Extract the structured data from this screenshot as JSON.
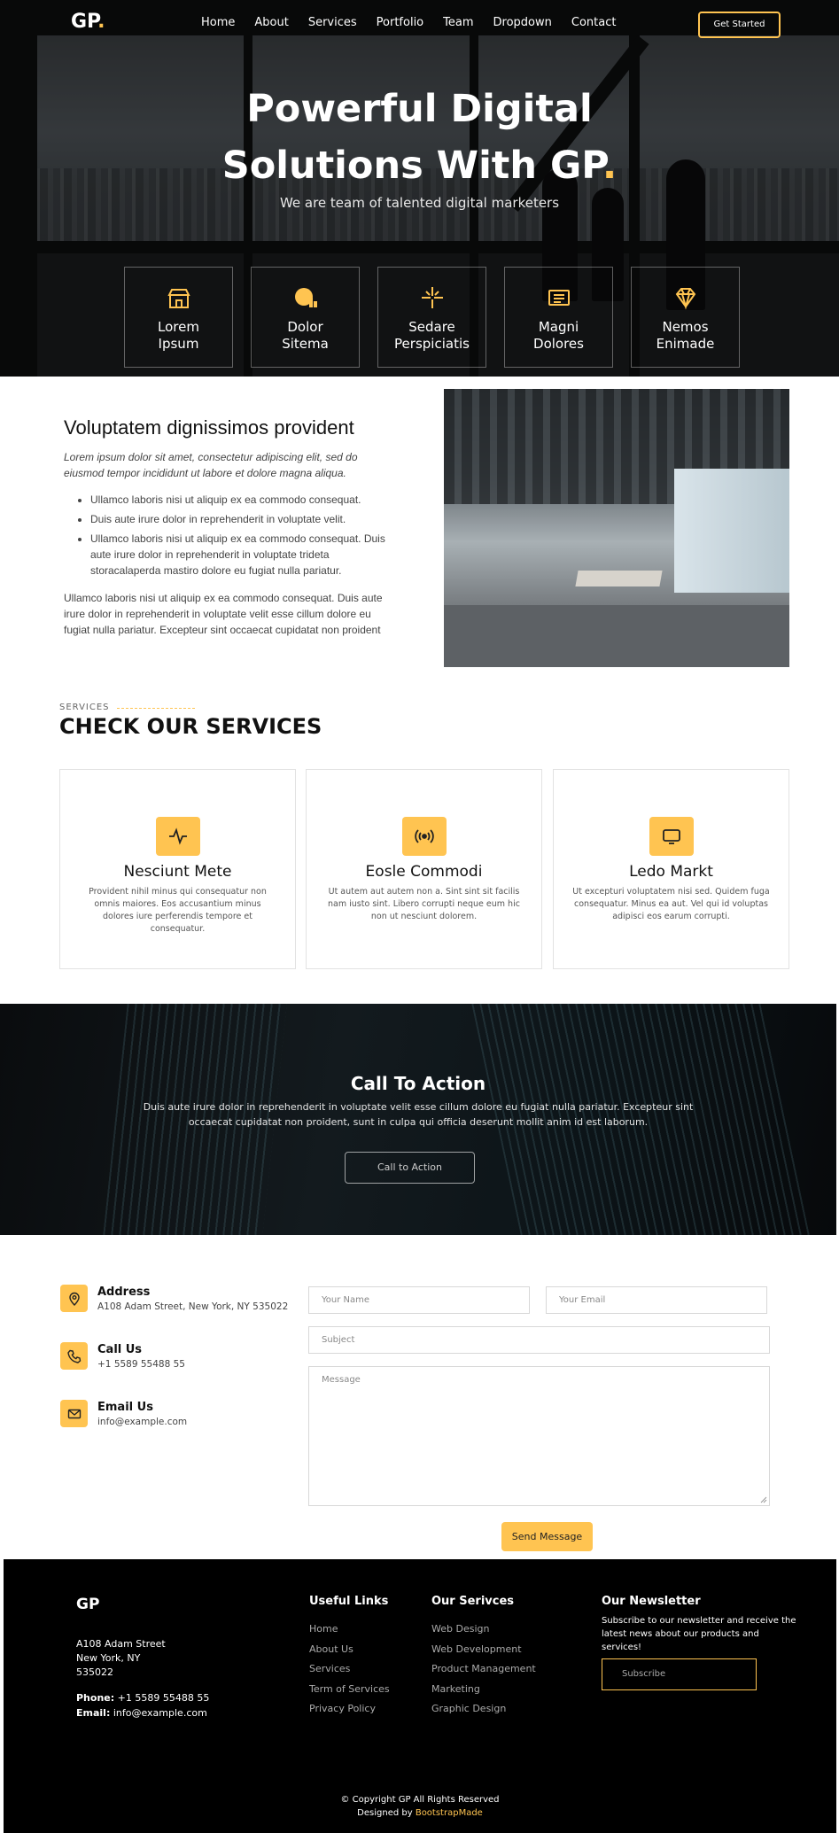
{
  "brand": {
    "name": "GP",
    "dot": ".",
    "accent_color": "#ffc451"
  },
  "nav": {
    "items": [
      "Home",
      "About",
      "Services",
      "Portfolio",
      "Team",
      "Dropdown",
      "Contact"
    ],
    "cta_label": "Get Started"
  },
  "hero": {
    "title_line1": "Powerful Digital",
    "title_line2": "Solutions With GP",
    "title_dot": ".",
    "subtitle": "We are team of talented digital marketers",
    "boxes": [
      {
        "icon": "store-icon",
        "line1": "Lorem",
        "line2": "Ipsum"
      },
      {
        "icon": "bar-chart-icon",
        "line1": "Dolor",
        "line2": "Sitema"
      },
      {
        "icon": "calendar-icon",
        "line1": "Sedare",
        "line2": "Perspiciatis"
      },
      {
        "icon": "paint-bucket-icon",
        "line1": "Magni",
        "line2": "Dolores"
      },
      {
        "icon": "gem-icon",
        "line1": "Nemos",
        "line2": "Enimade"
      }
    ]
  },
  "about": {
    "title": "Voluptatem dignissimos provident",
    "intro": "Lorem ipsum dolor sit amet, consectetur adipiscing elit, sed do eiusmod tempor incididunt ut labore et dolore magna aliqua.",
    "bullets": [
      "Ullamco laboris nisi ut aliquip ex ea commodo consequat.",
      "Duis aute irure dolor in reprehenderit in voluptate velit.",
      "Ullamco laboris nisi ut aliquip ex ea commodo consequat. Duis aute irure dolor in reprehenderit in voluptate trideta storacalaperda mastiro dolore eu fugiat nulla pariatur."
    ],
    "paragraph": "Ullamco laboris nisi ut aliquip ex ea commodo consequat. Duis aute irure dolor in reprehenderit in voluptate velit esse cillum dolore eu fugiat nulla pariatur. Excepteur sint occaecat cupidatat non proident"
  },
  "services": {
    "eyebrow": "SERVICES",
    "title": "CHECK OUR SERVICES",
    "cards": [
      {
        "icon": "activity-icon",
        "name": "Nesciunt Mete",
        "desc": "Provident nihil minus qui consequatur non omnis maiores. Eos accusantium minus dolores iure perferendis tempore et consequatur."
      },
      {
        "icon": "broadcast-icon",
        "name": "Eosle Commodi",
        "desc": "Ut autem aut autem non a. Sint sint sit facilis nam iusto sint. Libero corrupti neque eum hic non ut nesciunt dolorem."
      },
      {
        "icon": "monitor-icon",
        "name": "Ledo Markt",
        "desc": "Ut excepturi voluptatem nisi sed. Quidem fuga consequatur. Minus ea aut. Vel qui id voluptas adipisci eos earum corrupti."
      }
    ]
  },
  "cta": {
    "title": "Call To Action",
    "text": "Duis aute irure dolor in reprehenderit in voluptate velit esse cillum dolore eu fugiat nulla pariatur. Excepteur sint occaecat cupidatat non proident, sunt in culpa qui officia deserunt mollit anim id est laborum.",
    "button": "Call to Action"
  },
  "contact": {
    "info": [
      {
        "icon": "map-pin-icon",
        "title": "Address",
        "value": "A108 Adam Street, New York, NY 535022"
      },
      {
        "icon": "phone-icon",
        "title": "Call Us",
        "value": "+1 5589 55488 55"
      },
      {
        "icon": "envelope-icon",
        "title": "Email Us",
        "value": "info@example.com"
      }
    ],
    "form": {
      "name_placeholder": "Your Name",
      "email_placeholder": "Your Email",
      "subject_placeholder": "Subject",
      "message_placeholder": "Message",
      "send_label": "Send Message"
    }
  },
  "footer": {
    "logo": "GP",
    "address_line1": "A108 Adam Street",
    "address_line2": "New York, NY",
    "address_line3": "535022",
    "phone_label": "Phone:",
    "phone_value": " +1 5589 55488 55",
    "email_label": "Email:",
    "email_value": " info@example.com",
    "useful_links_title": "Useful Links",
    "useful_links": [
      "Home",
      "About Us",
      "Services",
      "Term of Services",
      "Privacy Policy"
    ],
    "services_title": "Our Serivces",
    "services_links": [
      "Web Design",
      "Web Development",
      "Product Management",
      "Marketing",
      "Graphic Design"
    ],
    "newsletter_title": "Our Newsletter",
    "newsletter_text": "Subscribe to our newsletter and receive the latest news about our products and services!",
    "subscribe_label": "Subscribe",
    "copyright": "© Copyright GP All Rights Reserved",
    "designed_by": "Designed by ",
    "designer": "BootstrapMade"
  }
}
